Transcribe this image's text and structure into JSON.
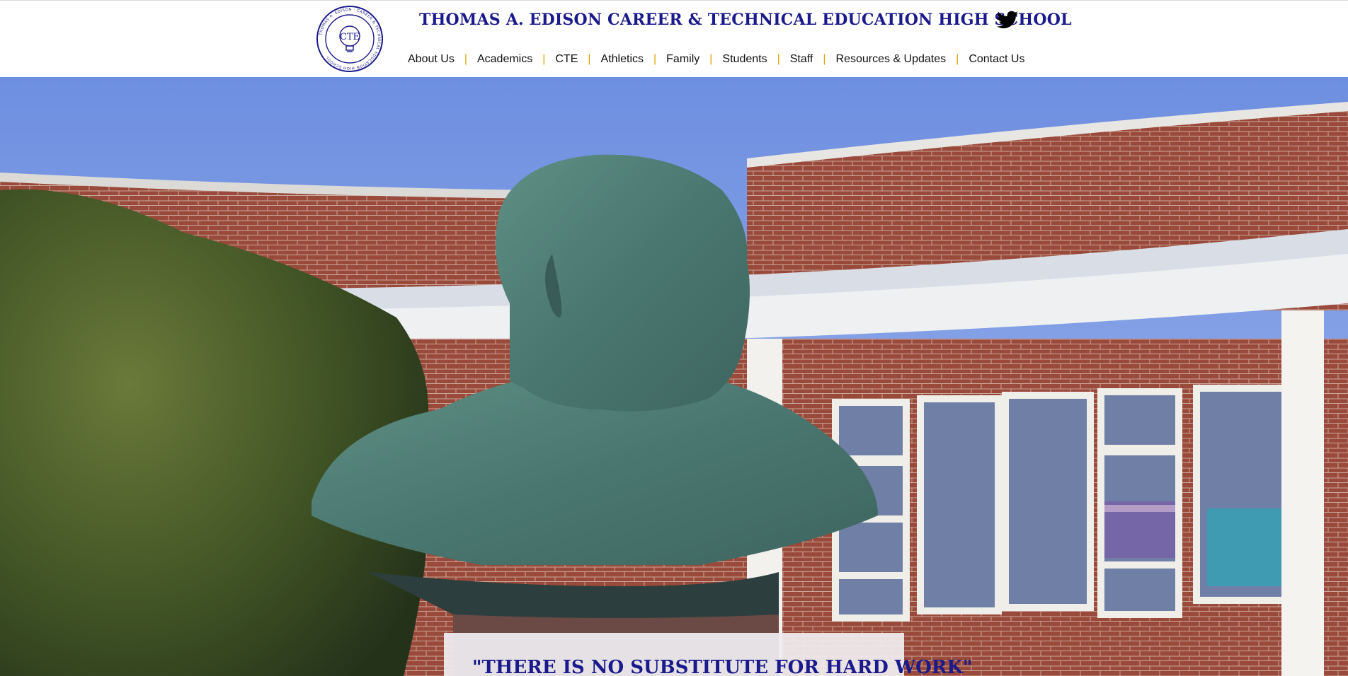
{
  "header": {
    "logo": {
      "icon": "school-seal-icon",
      "ring_text": "THOMAS A. EDISON · CAREER & TECHNICAL EDUCATION HIGH SCHOOL",
      "center_text": "CTE"
    },
    "title": "THOMAS A. EDISON CAREER & TECHNICAL EDUCATION HIGH SCHOOL",
    "social_icon": "twitter-icon"
  },
  "nav": {
    "items": [
      {
        "label": "About Us"
      },
      {
        "label": "Academics"
      },
      {
        "label": "CTE"
      },
      {
        "label": "Athletics"
      },
      {
        "label": "Family"
      },
      {
        "label": "Students"
      },
      {
        "label": "Staff"
      },
      {
        "label": "Resources & Updates"
      },
      {
        "label": "Contact Us"
      }
    ],
    "separator": "|"
  },
  "hero": {
    "image": "bronze-bust-of-thomas-edison-in-front-of-school-building",
    "quote": "\"THERE IS NO SUBSTITUTE FOR HARD WORK\""
  },
  "colors": {
    "title_blue": "#1a1a8c",
    "separator_gold": "#e0a400",
    "nav_text": "#111111"
  }
}
